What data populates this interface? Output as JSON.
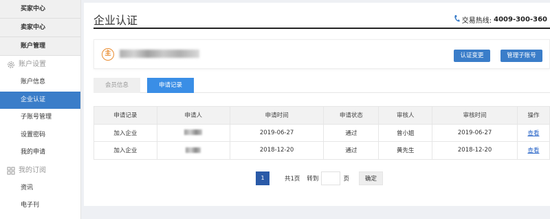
{
  "sidebar": {
    "heads": [
      "买家中心",
      "卖家中心",
      "账户管理"
    ],
    "group_account": "账户设置",
    "account_items": [
      "账户信息",
      "企业认证",
      "子账号管理",
      "设置密码",
      "我的申请"
    ],
    "group_subscribe": "我的订阅",
    "subscribe_items": [
      "资讯",
      "电子刊"
    ],
    "active_index": 1
  },
  "header": {
    "title": "企业认证",
    "hotline_label": "交易热线:",
    "hotline_number": "4009-300-360"
  },
  "company": {
    "badge": "主",
    "btn_verify": "认证变更",
    "btn_sub": "管理子账号"
  },
  "tabs": [
    {
      "label": "会员信息",
      "active": false
    },
    {
      "label": "申请记录",
      "active": true
    }
  ],
  "table": {
    "headers": [
      "申请记录",
      "申请人",
      "申请时间",
      "申请状态",
      "审核人",
      "审核时间",
      "操作"
    ],
    "rows": [
      {
        "record": "加入企业",
        "apply_time": "2019-06-27",
        "status": "通过",
        "reviewer": "曾小姐",
        "review_time": "2019-06-27",
        "action": "查看"
      },
      {
        "record": "加入企业",
        "apply_time": "2018-12-20",
        "status": "通过",
        "reviewer": "黄先生",
        "review_time": "2018-12-20",
        "action": "查看"
      }
    ]
  },
  "pager": {
    "current": "1",
    "total": "共1页",
    "goto": "转到",
    "unit": "页",
    "confirm": "确定"
  },
  "colors": {
    "accent": "#3a7dc9",
    "status_pass": "#22c222",
    "link": "#2a66c8",
    "badge": "#e98a2c"
  }
}
